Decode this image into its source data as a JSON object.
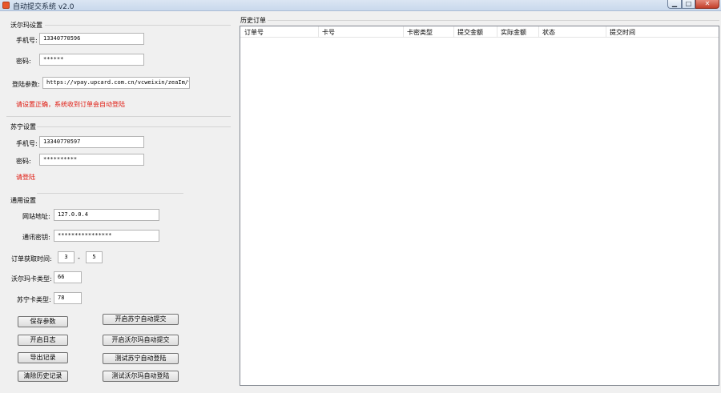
{
  "window": {
    "title": "自动提交系统 v2.0",
    "minimize_glyph": "▁",
    "maximize_glyph": "□",
    "close_glyph": "✕"
  },
  "walmart": {
    "title": "沃尔玛设置",
    "phone_label": "手机号:",
    "phone_value": "13340770596",
    "password_label": "密码:",
    "password_value": "******",
    "login_params_label": "登陆参数:",
    "login_params_value": "https://vpay.upcard.com.cn/vcweixin/zeaIm/togo",
    "hint": "请设置正确，系统收到订单会自动登陆"
  },
  "suning": {
    "title": "苏宁设置",
    "phone_label": "手机号:",
    "phone_value": "13340770597",
    "password_label": "密码:",
    "password_value": "**********",
    "status": "请登陆"
  },
  "general": {
    "title": "通用设置",
    "site_label": "网站地址:",
    "site_value": "127.0.0.4",
    "key_label": "通讯密钥:",
    "key_value": "****************",
    "interval_label": "订单获取时间:",
    "interval_from": "3",
    "interval_sep": "-",
    "interval_to": "5",
    "walmart_type_label": "沃尔玛卡类型:",
    "walmart_type_value": "66",
    "suning_type_label": "苏宁卡类型:",
    "suning_type_value": "78"
  },
  "buttons": {
    "save": "保存参数",
    "start_suning": "开启苏宁自动提交",
    "open_log": "开启日志",
    "start_walmart": "开启沃尔玛自动提交",
    "export": "导出记录",
    "test_suning_login": "测试苏宁自动登陆",
    "clear_history": "清除历史记录",
    "test_walmart_login": "测试沃尔玛自动登陆"
  },
  "history": {
    "title": "历史订单",
    "columns": [
      "订单号",
      "卡号",
      "卡密类型",
      "提交金额",
      "实际金额",
      "状态",
      "提交时间"
    ],
    "rows": []
  }
}
